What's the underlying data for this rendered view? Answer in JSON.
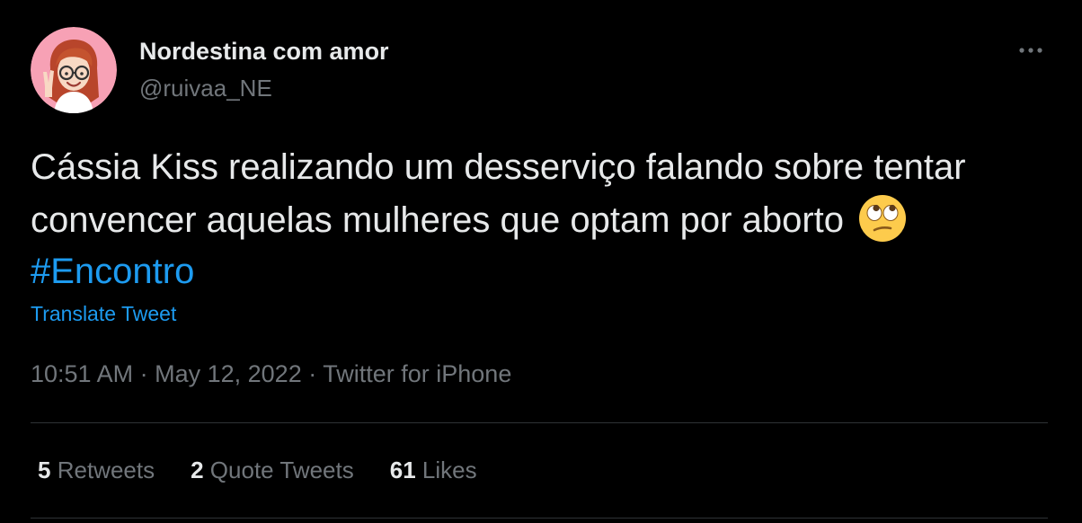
{
  "colors": {
    "background": "#000000",
    "text_primary": "#e7e9ea",
    "text_secondary": "#71767b",
    "accent": "#1d9bf0",
    "divider": "#2f3336",
    "avatar_bg": "#f7a1b5"
  },
  "author": {
    "display_name": "Nordestina com amor",
    "handle": "@ruivaa_NE",
    "avatar_icon": "cartoon-avatar-icon"
  },
  "tweet": {
    "text_part1": "Cássia Kiss realizando um desserviço falando sobre tentar convencer aquelas mulheres que optam por aborto",
    "emoji_icon": "face-with-rolling-eyes-emoji",
    "hashtag": "#Encontro",
    "translate_label": "Translate Tweet",
    "time": "10:51 AM",
    "separator": "·",
    "date": "May 12, 2022",
    "source": "Twitter for iPhone"
  },
  "stats": {
    "retweets_count": "5",
    "retweets_label": "Retweets",
    "quote_count": "2",
    "quote_label": "Quote Tweets",
    "likes_count": "61",
    "likes_label": "Likes"
  }
}
